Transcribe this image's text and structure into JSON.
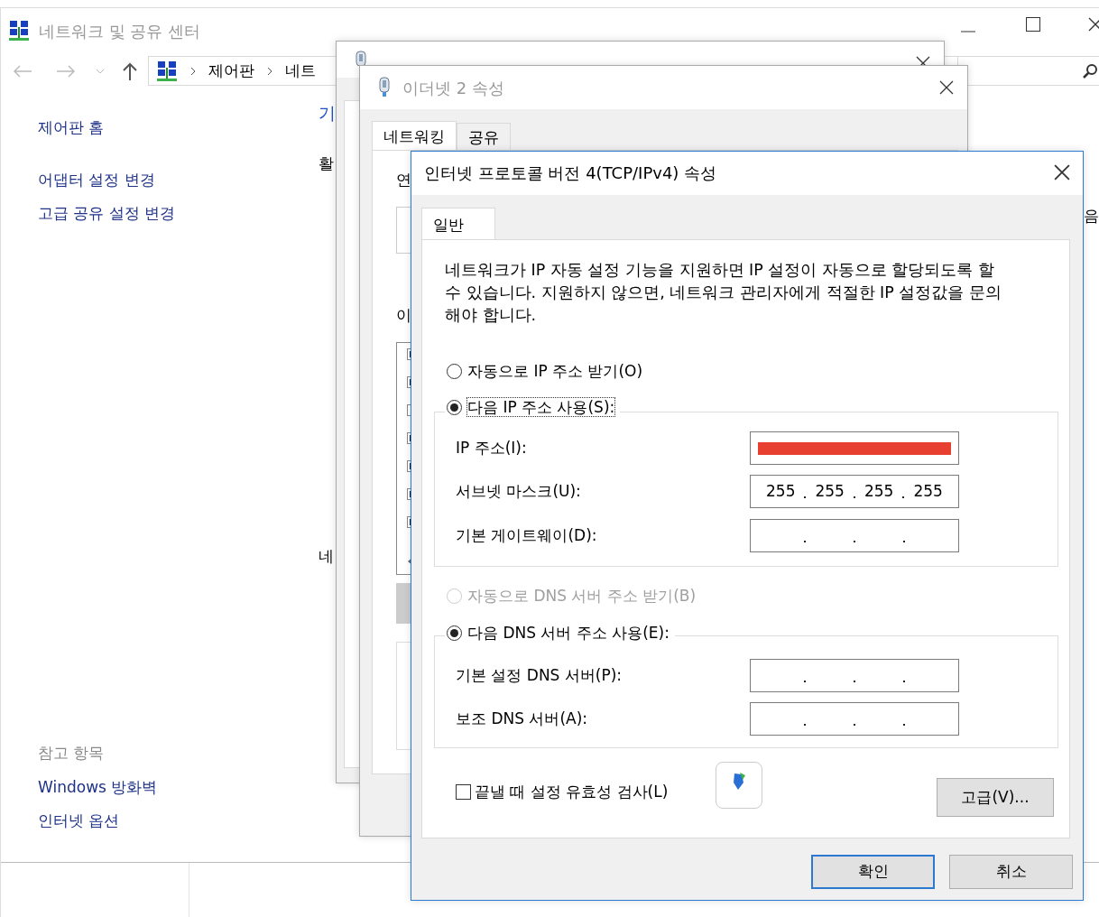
{
  "main_window": {
    "title": "네트워크 및 공유 센터",
    "breadcrumb": [
      "제어판",
      "네트"
    ],
    "sidebar": {
      "links": [
        "제어판 홈",
        "어댑터 설정 변경",
        "고급 공유 설정 변경"
      ],
      "see_also_heading": "참고 항목",
      "see_also": [
        "Windows 방화벽",
        "인터넷 옵션"
      ]
    },
    "content_fragments": [
      {
        "text": "기",
        "kind": "link"
      },
      {
        "text": "활",
        "kind": "text"
      },
      {
        "text": "네",
        "kind": "text"
      },
      {
        "text": "음",
        "kind": "edge"
      }
    ]
  },
  "properties_window": {
    "title": "이더넷 2 속성",
    "tabs": [
      {
        "label": "네트워킹",
        "selected": true
      },
      {
        "label": "공유",
        "selected": false
      }
    ],
    "fragments": [
      "연",
      "이"
    ],
    "components": [
      {
        "checked": true
      },
      {
        "checked": true
      },
      {
        "checked": false
      },
      {
        "checked": true
      },
      {
        "checked": true
      },
      {
        "checked": true
      },
      {
        "checked": true
      }
    ]
  },
  "ipv4_dialog": {
    "title": "인터넷 프로토콜 버전 4(TCP/IPv4) 속성",
    "tabs": [
      {
        "label": "일반",
        "selected": true
      }
    ],
    "description": "네트워크가 IP 자동 설정 기능을 지원하면 IP 설정이 자동으로 할당되도록 할 수 있습니다. 지원하지 않으면, 네트워크 관리자에게 적절한 IP 설정값을 문의해야 합니다.",
    "ip_options": [
      {
        "label": "자동으로 IP 주소 받기(O)",
        "selected": false,
        "disabled": false,
        "focused": false
      },
      {
        "label": "다음 IP 주소 사용(S):",
        "selected": true,
        "disabled": false,
        "focused": true
      }
    ],
    "ip_fields": [
      {
        "label": "IP 주소(I):",
        "redacted": true
      },
      {
        "label": "서브넷 마스크(U):",
        "octets": [
          "255",
          "255",
          "255",
          "255"
        ]
      },
      {
        "label": "기본 게이트웨이(D):"
      }
    ],
    "dns_options": [
      {
        "label": "자동으로 DNS 서버 주소 받기(B)",
        "selected": false,
        "disabled": true,
        "focused": false
      },
      {
        "label": "다음 DNS 서버 주소 사용(E):",
        "selected": true,
        "disabled": false,
        "focused": false
      }
    ],
    "dns_fields": [
      {
        "label": "기본 설정 DNS 서버(P):"
      },
      {
        "label": "보조 DNS 서버(A):"
      }
    ],
    "validate_on_exit": {
      "label": "끝낼 때 설정 유효성 검사(L)",
      "checked": false
    },
    "advanced_button": "고급(V)...",
    "buttons": [
      {
        "label": "확인",
        "default": true
      },
      {
        "label": "취소",
        "default": false
      }
    ]
  }
}
